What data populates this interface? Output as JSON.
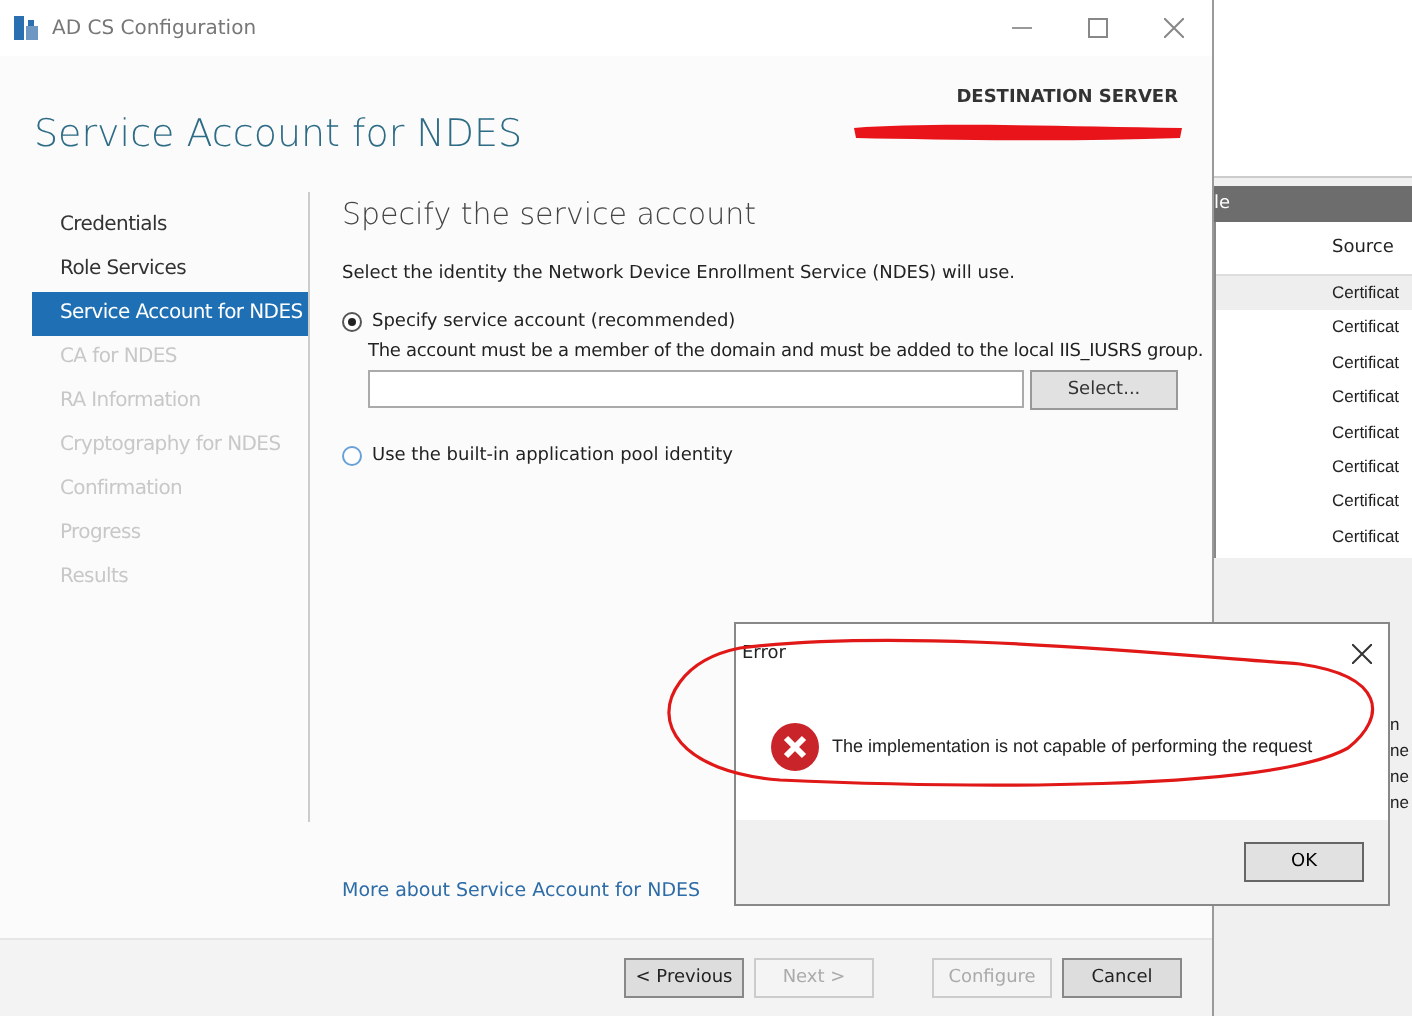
{
  "window": {
    "title": "AD CS Configuration"
  },
  "header": {
    "title": "Service Account for NDES",
    "destination_label": "DESTINATION SERVER"
  },
  "sidebar": {
    "items": [
      {
        "label": "Credentials",
        "selected": false,
        "disabled": false
      },
      {
        "label": "Role Services",
        "selected": false,
        "disabled": false
      },
      {
        "label": "Service Account for NDES",
        "selected": true,
        "disabled": false
      },
      {
        "label": "CA for NDES",
        "selected": false,
        "disabled": true
      },
      {
        "label": "RA Information",
        "selected": false,
        "disabled": true
      },
      {
        "label": "Cryptography for NDES",
        "selected": false,
        "disabled": true
      },
      {
        "label": "Confirmation",
        "selected": false,
        "disabled": true
      },
      {
        "label": "Progress",
        "selected": false,
        "disabled": true
      },
      {
        "label": "Results",
        "selected": false,
        "disabled": true
      }
    ]
  },
  "content": {
    "heading": "Specify the service account",
    "description": "Select the identity the Network Device Enrollment Service (NDES) will use.",
    "options": [
      {
        "label": "Specify service account (recommended)",
        "selected": true,
        "hint": "The account must be a member of the domain and must be added to the local IIS_IUSRS group.",
        "select_button": "Select..."
      },
      {
        "label": "Use the built-in application pool identity",
        "selected": false
      }
    ],
    "link": "More about Service Account for NDES"
  },
  "footer": {
    "buttons": [
      {
        "label": "< Previous",
        "disabled": false
      },
      {
        "label": "Next >",
        "disabled": true
      },
      {
        "label": "Configure",
        "disabled": true
      },
      {
        "label": "Cancel",
        "disabled": false
      }
    ]
  },
  "dialog": {
    "title": "Error",
    "message": "The implementation is not capable of performing the request",
    "button": "OK"
  },
  "background_window": {
    "title": "le",
    "column": "Source",
    "rows": [
      "Certificat",
      "Certificat",
      "Certificat",
      "Certificat",
      "Certificat",
      "Certificat",
      "Certificat",
      "Certificat"
    ],
    "fragments": [
      "n",
      "ne",
      "ne",
      "ne"
    ]
  }
}
